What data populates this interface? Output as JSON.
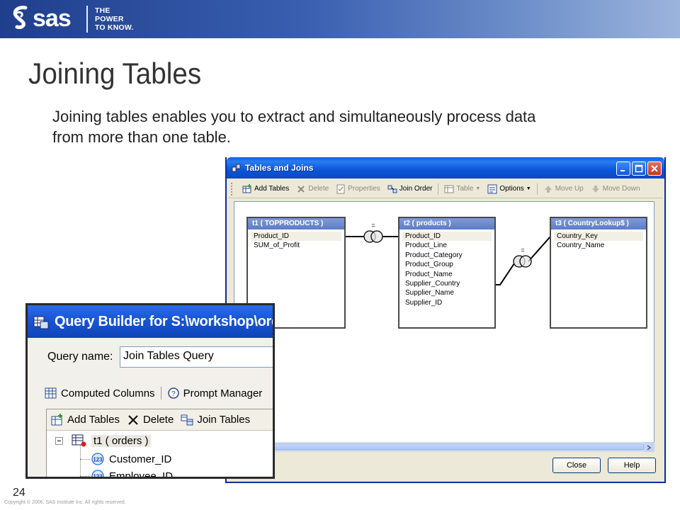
{
  "banner": {
    "logo_text": "sas",
    "tagline_line1": "THE",
    "tagline_line2": "POWER",
    "tagline_line3": "TO KNOW."
  },
  "slide": {
    "title": "Joining Tables",
    "body": "Joining tables enables you to extract and simultaneously process data from more than one table.",
    "page_number": "24",
    "copyright": "Copyright © 2006, SAS Institute Inc. All rights reserved."
  },
  "tables_joins": {
    "title": "Tables and Joins",
    "toolbar": [
      {
        "label": "Add Tables",
        "icon": "add-tables-icon",
        "enabled": true
      },
      {
        "label": "Delete",
        "icon": "delete-icon",
        "enabled": false
      },
      {
        "label": "Properties",
        "icon": "properties-icon",
        "enabled": false
      },
      {
        "label": "Join Order",
        "icon": "join-order-icon",
        "enabled": true
      },
      {
        "label": "Table",
        "icon": "table-icon",
        "enabled": false
      },
      {
        "label": "Options",
        "icon": "options-icon",
        "enabled": true
      },
      {
        "label": "Move Up",
        "icon": "move-up-icon",
        "enabled": false
      },
      {
        "label": "Move Down",
        "icon": "move-down-icon",
        "enabled": false
      }
    ],
    "tables": [
      {
        "header": "t1 ( TOPPRODUCTS )",
        "columns": [
          "Product_ID",
          "SUM_of_Profit"
        ]
      },
      {
        "header": "t2 ( products )",
        "columns": [
          "Product_ID",
          "Product_Line",
          "Product_Category",
          "Product_Group",
          "Product_Name",
          "Supplier_Country",
          "Supplier_Name",
          "Supplier_ID"
        ]
      },
      {
        "header": "t3 ( CountryLookup$ )",
        "columns": [
          "Country_Key",
          "Country_Name"
        ]
      }
    ],
    "join_symbols": [
      "=",
      "="
    ],
    "close_label": "Close",
    "help_label": "Help"
  },
  "query_builder": {
    "title": "Query Builder for S:\\workshop\\orde",
    "query_name_label": "Query name:",
    "query_name_value": "Join Tables Query",
    "computed_columns_label": "Computed Columns",
    "prompt_manager_label": "Prompt Manager",
    "add_tables_label": "Add Tables",
    "delete_label": "Delete",
    "join_tables_label": "Join Tables",
    "tree_table": "t1 ( orders )",
    "tree_columns": [
      "Customer_ID",
      "Employee_ID"
    ]
  },
  "colors": {
    "banner_blue": "#1f3f8c",
    "titlebar_blue": "#0a5fe6",
    "table_header_blue": "#6f8bd2"
  }
}
